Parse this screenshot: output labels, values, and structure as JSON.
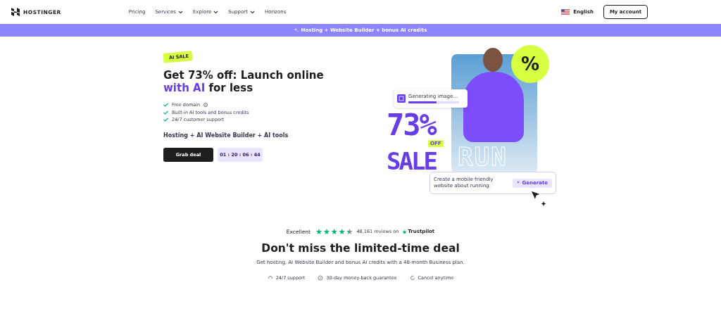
{
  "header": {
    "brand": "HOSTINGER",
    "nav": [
      {
        "label": "Pricing",
        "dropdown": false
      },
      {
        "label": "Services",
        "dropdown": true
      },
      {
        "label": "Explore",
        "dropdown": true
      },
      {
        "label": "Support",
        "dropdown": true
      },
      {
        "label": "Horizons",
        "dropdown": false
      }
    ],
    "language": "English",
    "account_button": "My account"
  },
  "promo_bar": {
    "text": "Hosting + Website Builder + bonus AI credits"
  },
  "hero": {
    "tag": "AI SALE",
    "title": "Get 73% off: Launch online",
    "title_line2": "**with AI** for less",
    "features": [
      {
        "text": "Free domain",
        "info": true
      },
      {
        "text": "Built-in AI tools and bonus credits",
        "info": false
      },
      {
        "text": "24/7 customer support",
        "info": false
      }
    ],
    "subtitle": "Hosting + AI Website Builder + AI tools",
    "cta": "Grab deal",
    "countdown": "01 : 20 : 06 : 44",
    "artwork": {
      "percent_badge": "%",
      "generating_label": "Generating image...",
      "generating_bar": {
        "level": 0.55
      },
      "sale_number": "73%",
      "off_badge": "OFF",
      "sale_word": "SALE",
      "outline_word": "RUN",
      "prompt": "Create a mobile friendly website about running:",
      "generate_button": "Generate"
    }
  },
  "rating": {
    "label": "Excellent",
    "stars": 4.5,
    "reviews": "48,161 reviews on",
    "source": "Trustpilot"
  },
  "deal": {
    "title": "Don't miss the limited-time deal",
    "text": "Get hosting, AI Website Builder and bonus AI credits with a 48-month Business plan.",
    "perks": [
      {
        "kind": "support",
        "text": "24/7 support"
      },
      {
        "kind": "guarantee",
        "text": "30-day money-back guarantee"
      },
      {
        "kind": "cancel",
        "text": "Cancel anytime"
      }
    ]
  }
}
